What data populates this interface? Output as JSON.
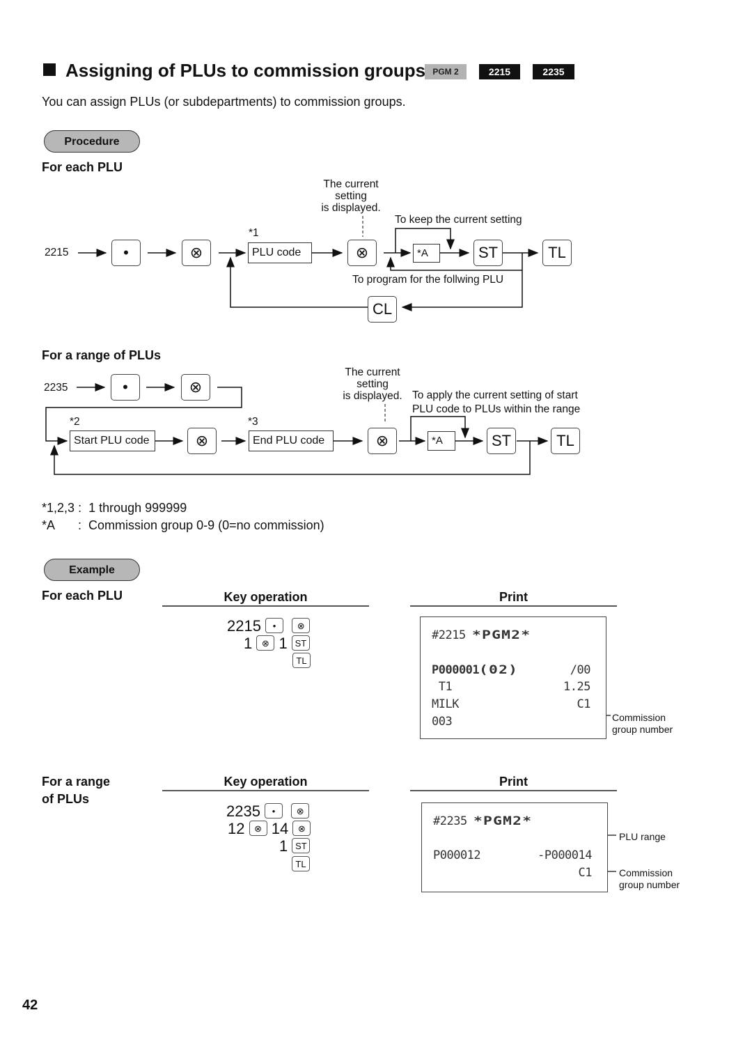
{
  "header": {
    "title": "Assigning of PLUs to commission groups",
    "tags": [
      "PGM 2",
      "2215",
      "2235"
    ],
    "intro": "You can assign PLUs (or subdepartments) to commission groups."
  },
  "procedure": {
    "label": "Procedure",
    "each_plu": {
      "heading": "For each PLU",
      "start_code": "2215",
      "note_current": [
        "The current",
        "setting",
        "is displayed."
      ],
      "note_keep": "To keep the current setting",
      "note_next": "To program for the follwing PLU",
      "star1": "*1",
      "keys": {
        "point": "•",
        "mult": "⊗",
        "plu_code": "PLU code",
        "a": "*A",
        "st": "ST",
        "tl": "TL",
        "cl": "CL"
      }
    },
    "range": {
      "heading": "For a range of PLUs",
      "start_code": "2235",
      "note_current": [
        "The current",
        "setting",
        "is displayed."
      ],
      "note_apply": [
        "To apply the current setting of start",
        "PLU code to PLUs within the range"
      ],
      "star2": "*2",
      "star3": "*3",
      "keys": {
        "point": "•",
        "mult": "⊗",
        "start_plu": "Start PLU code",
        "end_plu": "End PLU code",
        "a": "*A",
        "st": "ST",
        "tl": "TL"
      }
    }
  },
  "notes": [
    {
      "key": "*1,2,3",
      "sep": ":",
      "text": "1 through 999999"
    },
    {
      "key": "*A",
      "sep": ":",
      "text": "Commission group 0-9 (0=no commission)"
    }
  ],
  "example": {
    "label": "Example",
    "key_operation_header": "Key operation",
    "print_header": "Print",
    "each_plu": {
      "heading": "For each PLU",
      "ops": [
        {
          "num": "2215",
          "k1": "•",
          "k2": "⊗"
        },
        {
          "num": "1",
          "k1": "⊗",
          "num2": "1",
          "k2": "ST"
        },
        {
          "k2": "TL"
        }
      ],
      "receipt": {
        "header": "#2215 ",
        "header_wide": "*PGM2*",
        "plu_line_left": "P000001",
        "plu_line_dept": "(02)",
        "plu_line_right": "/00",
        "t1_left": " T1",
        "t1_right": "1.25",
        "name": "MILK",
        "group": "C1",
        "code": "003"
      },
      "callout": [
        "Commission",
        "group number"
      ]
    },
    "range": {
      "heading": [
        "For a range",
        "of PLUs"
      ],
      "ops": [
        {
          "num": "2235",
          "k1": "•",
          "k2": "⊗"
        },
        {
          "num": "12",
          "k1": "⊗",
          "num2": "14",
          "k2": "⊗"
        },
        {
          "num2": "1",
          "k2": "ST"
        },
        {
          "k2": "TL"
        }
      ],
      "receipt": {
        "header": "#2235 ",
        "header_wide": "*PGM2*",
        "start": "P000012",
        "end": "-P000014",
        "group": "C1"
      },
      "callout_range": "PLU range",
      "callout_group": [
        "Commission",
        "group number"
      ]
    }
  },
  "page_number": "42"
}
